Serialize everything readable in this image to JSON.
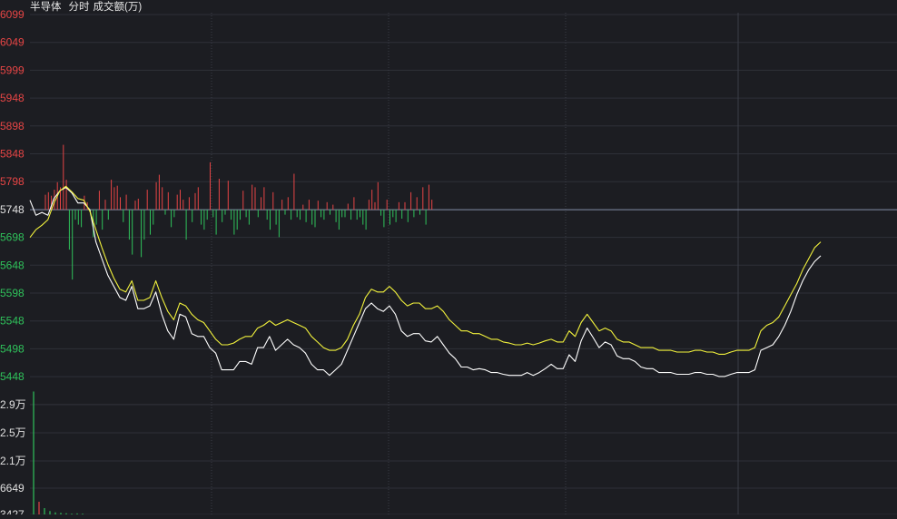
{
  "header": {
    "title": "半导体",
    "mode": "分时",
    "volume_label": "成交额(万)"
  },
  "colors": {
    "background": "#1c1d22",
    "up": "#e64545",
    "down": "#2fc25b",
    "price_line": "#ffffff",
    "avg_line": "#f2f23c",
    "grid": "#2e3038",
    "base_line": "#7f8aa3"
  },
  "chart_data": {
    "type": "line",
    "title": "半导体",
    "price_axis": {
      "ticks": [
        "6099",
        "6049",
        "5999",
        "5948",
        "5898",
        "5848",
        "5798",
        "5748",
        "5698",
        "5648",
        "5598",
        "5548",
        "5498",
        "5448"
      ],
      "tick_colors": [
        "up",
        "up",
        "up",
        "up",
        "up",
        "up",
        "up",
        "flat",
        "down",
        "down",
        "down",
        "down",
        "down",
        "down"
      ],
      "ylim": [
        5415,
        6099
      ],
      "pre_close": 5748
    },
    "volume_axis": {
      "label": "成交额(万)",
      "ticks": [
        "2.9万",
        "2.5万",
        "2.1万",
        "6649",
        "3427"
      ],
      "ylim": [
        0,
        29000
      ]
    },
    "series": [
      {
        "name": "price",
        "color": "#ffffff",
        "values": [
          5765,
          5738,
          5743,
          5738,
          5768,
          5782,
          5788,
          5778,
          5760,
          5760,
          5748,
          5690,
          5660,
          5630,
          5610,
          5590,
          5585,
          5610,
          5570,
          5570,
          5575,
          5600,
          5560,
          5530,
          5515,
          5560,
          5555,
          5525,
          5520,
          5520,
          5500,
          5490,
          5460,
          5460,
          5460,
          5475,
          5475,
          5470,
          5500,
          5500,
          5520,
          5495,
          5505,
          5515,
          5505,
          5500,
          5490,
          5470,
          5460,
          5460,
          5450,
          5460,
          5470,
          5495,
          5520,
          5545,
          5570,
          5580,
          5570,
          5565,
          5575,
          5560,
          5530,
          5520,
          5525,
          5525,
          5512,
          5510,
          5520,
          5505,
          5490,
          5480,
          5465,
          5465,
          5460,
          5462,
          5460,
          5455,
          5455,
          5452,
          5450,
          5450,
          5450,
          5455,
          5450,
          5455,
          5462,
          5470,
          5462,
          5462,
          5487,
          5475,
          5512,
          5535,
          5518,
          5500,
          5510,
          5505,
          5485,
          5480,
          5480,
          5475,
          5465,
          5462,
          5462,
          5455,
          5455,
          5455,
          5452,
          5452,
          5452,
          5455,
          5455,
          5452,
          5452,
          5448,
          5448,
          5452,
          5455,
          5455,
          5455,
          5460,
          5495,
          5500,
          5505,
          5520,
          5540,
          5565,
          5595,
          5620,
          5640,
          5655,
          5665
        ],
        "note_unused_marker": ""
      },
      {
        "name": "average",
        "color": "#f2f23c",
        "values": [
          5698,
          5712,
          5720,
          5730,
          5760,
          5782,
          5790,
          5780,
          5768,
          5765,
          5745,
          5712,
          5680,
          5650,
          5625,
          5605,
          5600,
          5620,
          5585,
          5585,
          5590,
          5620,
          5590,
          5565,
          5550,
          5580,
          5575,
          5560,
          5550,
          5545,
          5530,
          5515,
          5505,
          5505,
          5508,
          5515,
          5520,
          5520,
          5535,
          5540,
          5548,
          5540,
          5545,
          5550,
          5545,
          5540,
          5535,
          5520,
          5510,
          5500,
          5495,
          5495,
          5500,
          5515,
          5540,
          5560,
          5590,
          5605,
          5600,
          5600,
          5610,
          5600,
          5585,
          5575,
          5580,
          5580,
          5570,
          5570,
          5575,
          5565,
          5550,
          5540,
          5530,
          5530,
          5525,
          5525,
          5520,
          5515,
          5515,
          5510,
          5508,
          5505,
          5505,
          5508,
          5505,
          5508,
          5512,
          5515,
          5510,
          5510,
          5530,
          5520,
          5545,
          5560,
          5545,
          5530,
          5535,
          5530,
          5515,
          5510,
          5510,
          5505,
          5500,
          5500,
          5500,
          5495,
          5495,
          5495,
          5492,
          5492,
          5492,
          5495,
          5495,
          5492,
          5492,
          5488,
          5488,
          5492,
          5495,
          5495,
          5495,
          5500,
          5530,
          5540,
          5545,
          5555,
          5575,
          5595,
          5615,
          5640,
          5660,
          5680,
          5690
        ]
      }
    ],
    "volume_bars": [
      29000,
      3000,
      1500,
      800,
      500,
      400,
      300,
      200,
      250,
      200
    ],
    "delta_bars": [
      30,
      35,
      28,
      40,
      55,
      45,
      130,
      60,
      -80,
      -140,
      -20,
      -30,
      -35,
      28,
      15,
      -10,
      -55,
      -30,
      38,
      -40,
      20,
      -20,
      60,
      45,
      48,
      25,
      -25,
      30,
      -60,
      -90,
      18,
      22,
      -95,
      -60,
      40,
      -50,
      -30,
      55,
      70,
      45,
      -10,
      35,
      -35,
      -15,
      30,
      40,
      20,
      -60,
      25,
      -25,
      33,
      45,
      -30,
      -40,
      -20,
      95,
      -15,
      -50,
      62,
      -25,
      -10,
      58,
      -20,
      -50,
      -40,
      -20,
      38,
      -15,
      -30,
      50,
      45,
      -15,
      25,
      45,
      -20,
      -40,
      35,
      -30,
      -55,
      20,
      -10,
      25,
      -20,
      72,
      -15,
      -20,
      10,
      -25,
      20,
      -30,
      -35,
      18,
      -15,
      -20,
      15,
      -10,
      10,
      -25,
      -40,
      -15,
      -15,
      12,
      -20,
      25,
      -20,
      -15,
      -30,
      -40,
      20,
      40,
      15,
      55,
      -12,
      -35,
      20,
      -30,
      -15,
      -25,
      15,
      -18,
      15,
      -25,
      35,
      -15,
      25,
      -10,
      45,
      -30,
      50,
      20
    ],
    "grid": true
  }
}
